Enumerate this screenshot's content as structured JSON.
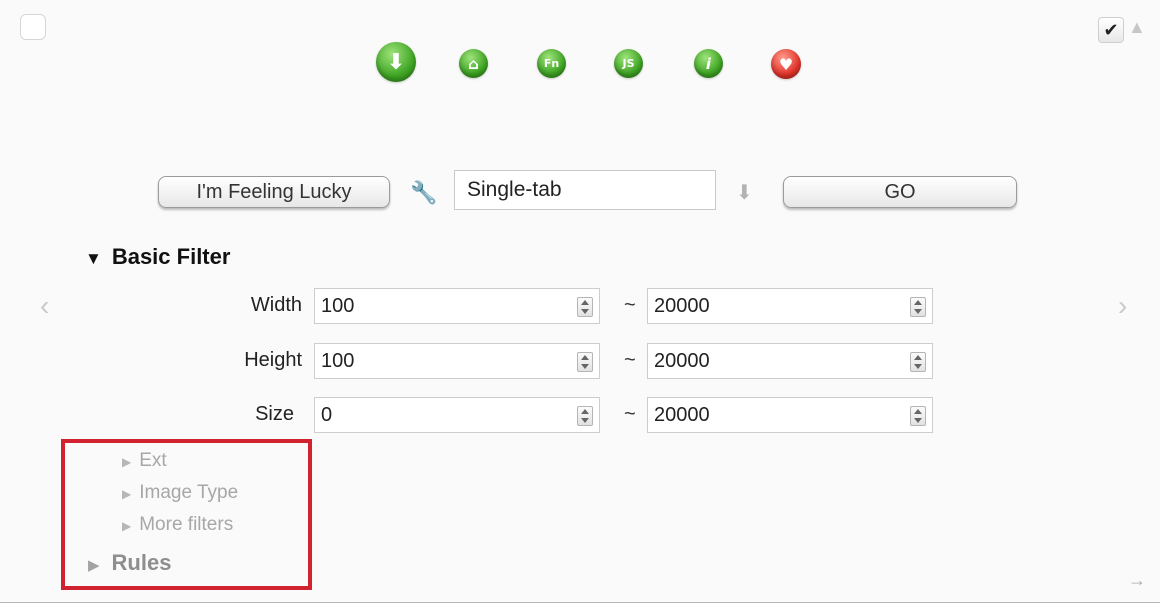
{
  "toolbar": {
    "icons": [
      {
        "name": "download-icon",
        "glyph": "⬇",
        "color": "#3fa524"
      },
      {
        "name": "home-icon",
        "glyph": "⌂",
        "color": "#3fa524"
      },
      {
        "name": "fn-icon",
        "glyph": "Fn",
        "color": "#3fa524"
      },
      {
        "name": "js-icon",
        "glyph": "JS",
        "color": "#3fa524"
      },
      {
        "name": "info-icon",
        "glyph": "i",
        "color": "#3fa524"
      },
      {
        "name": "heart-icon",
        "glyph": "♥",
        "color": "#e2352b"
      }
    ],
    "check_glyph": "✔",
    "scroll_up_glyph": "▲"
  },
  "controls": {
    "lucky_label": "I'm Feeling Lucky",
    "mode_value": "Single-tab",
    "go_label": "GO",
    "wrench_glyph": "🔧",
    "down_arrow_glyph": "⬇"
  },
  "basic_filter": {
    "title": "Basic Filter",
    "expanded_glyph": "▼",
    "rows": [
      {
        "label": "Width",
        "min": "100",
        "max": "20000"
      },
      {
        "label": "Height",
        "min": "100",
        "max": "20000"
      },
      {
        "label": "Size",
        "min": "0",
        "max": "20000"
      }
    ],
    "separator": "~"
  },
  "nav": {
    "prev_glyph": "‹",
    "next_glyph": "›",
    "bottom_arrow_glyph": "→"
  },
  "collapsed_sections": [
    {
      "label": "Ext"
    },
    {
      "label": "Image Type"
    },
    {
      "label": "More filters"
    }
  ],
  "rules": {
    "label": "Rules"
  },
  "collapsed_glyph": "▶",
  "colors": {
    "highlight": "#d0222f",
    "accent_green": "#3fa524",
    "accent_red": "#e2352b"
  }
}
